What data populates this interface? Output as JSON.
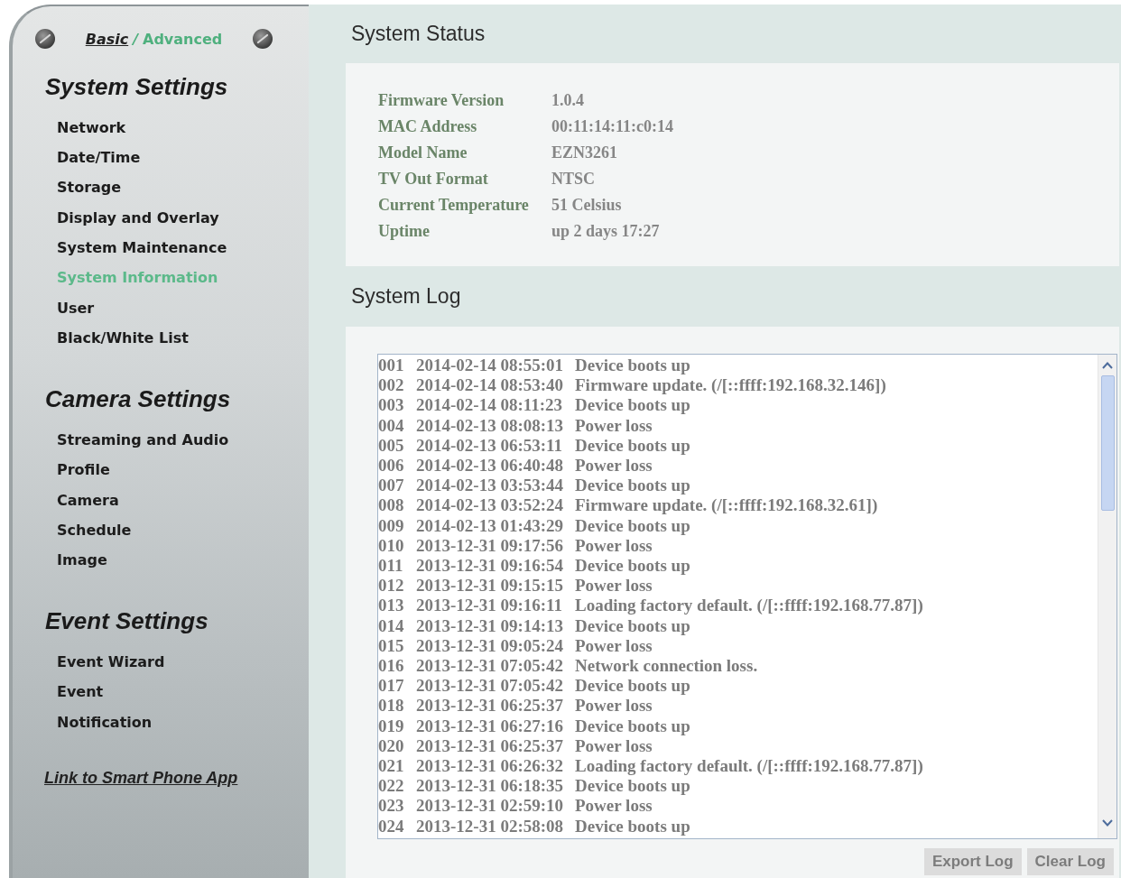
{
  "mode_switch": {
    "options": [
      {
        "label": "Basic",
        "selected": false
      },
      {
        "label": "Advanced",
        "selected": true
      }
    ],
    "separator": "/"
  },
  "sidebar": {
    "sections": [
      {
        "title": "System Settings",
        "items": [
          {
            "label": "Network",
            "selected": false
          },
          {
            "label": "Date/Time",
            "selected": false
          },
          {
            "label": "Storage",
            "selected": false
          },
          {
            "label": "Display and Overlay",
            "selected": false
          },
          {
            "label": "System Maintenance",
            "selected": false
          },
          {
            "label": "System Information",
            "selected": true
          },
          {
            "label": "User",
            "selected": false
          },
          {
            "label": "Black/White List",
            "selected": false
          }
        ]
      },
      {
        "title": "Camera Settings",
        "items": [
          {
            "label": "Streaming and Audio",
            "selected": false
          },
          {
            "label": "Profile",
            "selected": false
          },
          {
            "label": "Camera",
            "selected": false
          },
          {
            "label": "Schedule",
            "selected": false
          },
          {
            "label": "Image",
            "selected": false
          }
        ]
      },
      {
        "title": "Event Settings",
        "items": [
          {
            "label": "Event Wizard",
            "selected": false
          },
          {
            "label": "Event",
            "selected": false
          },
          {
            "label": "Notification",
            "selected": false
          }
        ]
      }
    ],
    "link": "Link to Smart Phone App"
  },
  "status": {
    "title": "System Status",
    "fields": [
      {
        "label": "Firmware Version",
        "value": "1.0.4"
      },
      {
        "label": "MAC Address",
        "value": "00:11:14:11:c0:14"
      },
      {
        "label": "Model Name",
        "value": "EZN3261"
      },
      {
        "label": "TV Out Format",
        "value": "NTSC"
      },
      {
        "label": "Current Temperature",
        "value": "51 Celsius"
      },
      {
        "label": "Uptime",
        "value": "up 2 days 17:27"
      }
    ]
  },
  "log": {
    "title": "System Log",
    "entries": [
      {
        "number": "001",
        "time": "2014-02-14 08:55:01",
        "message": "Device boots up"
      },
      {
        "number": "002",
        "time": "2014-02-14 08:53:40",
        "message": "Firmware update. (/[::ffff:192.168.32.146])"
      },
      {
        "number": "003",
        "time": "2014-02-14 08:11:23",
        "message": "Device boots up"
      },
      {
        "number": "004",
        "time": "2014-02-13 08:08:13",
        "message": "Power loss"
      },
      {
        "number": "005",
        "time": "2014-02-13 06:53:11",
        "message": "Device boots up"
      },
      {
        "number": "006",
        "time": "2014-02-13 06:40:48",
        "message": "Power loss"
      },
      {
        "number": "007",
        "time": "2014-02-13 03:53:44",
        "message": "Device boots up"
      },
      {
        "number": "008",
        "time": "2014-02-13 03:52:24",
        "message": "Firmware update. (/[::ffff:192.168.32.61])"
      },
      {
        "number": "009",
        "time": "2014-02-13 01:43:29",
        "message": "Device boots up"
      },
      {
        "number": "010",
        "time": "2013-12-31 09:17:56",
        "message": "Power loss"
      },
      {
        "number": "011",
        "time": "2013-12-31 09:16:54",
        "message": "Device boots up"
      },
      {
        "number": "012",
        "time": "2013-12-31 09:15:15",
        "message": "Power loss"
      },
      {
        "number": "013",
        "time": "2013-12-31 09:16:11",
        "message": "Loading factory default. (/[::ffff:192.168.77.87])"
      },
      {
        "number": "014",
        "time": "2013-12-31 09:14:13",
        "message": "Device boots up"
      },
      {
        "number": "015",
        "time": "2013-12-31 09:05:24",
        "message": "Power loss"
      },
      {
        "number": "016",
        "time": "2013-12-31 07:05:42",
        "message": "Network connection loss."
      },
      {
        "number": "017",
        "time": "2013-12-31 07:05:42",
        "message": "Device boots up"
      },
      {
        "number": "018",
        "time": "2013-12-31 06:25:37",
        "message": "Power loss"
      },
      {
        "number": "019",
        "time": "2013-12-31 06:27:16",
        "message": "Device boots up"
      },
      {
        "number": "020",
        "time": "2013-12-31 06:25:37",
        "message": "Power loss"
      },
      {
        "number": "021",
        "time": "2013-12-31 06:26:32",
        "message": "Loading factory default. (/[::ffff:192.168.77.87])"
      },
      {
        "number": "022",
        "time": "2013-12-31 06:18:35",
        "message": "Device boots up"
      },
      {
        "number": "023",
        "time": "2013-12-31 02:59:10",
        "message": "Power loss"
      },
      {
        "number": "024",
        "time": "2013-12-31 02:58:08",
        "message": "Device boots up"
      }
    ],
    "buttons": [
      "Export Log",
      "Clear Log"
    ]
  }
}
